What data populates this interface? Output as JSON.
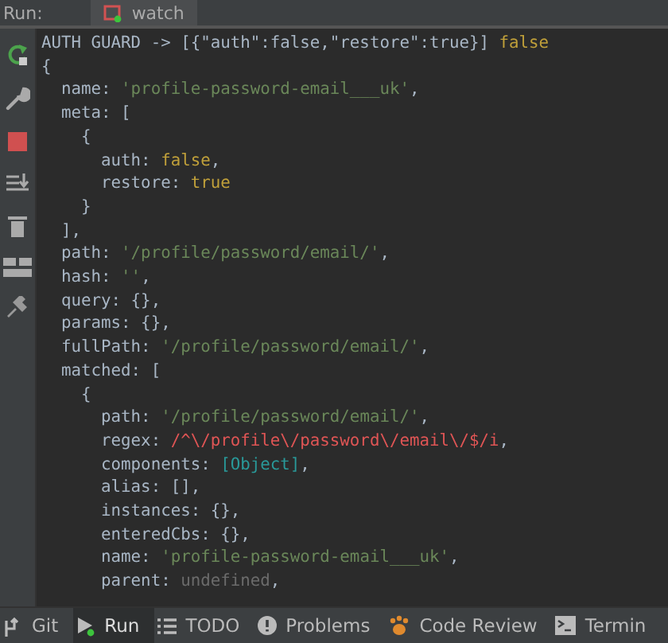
{
  "top_bar": {
    "label": "Run:",
    "tabs": [
      {
        "label": "watch",
        "selected": true
      }
    ]
  },
  "console_lines": [
    {
      "segments": [
        {
          "kind": "plain",
          "text": "AUTH GUARD -> [{\"auth\":false,\"restore\":true}] "
        },
        {
          "kind": "bool",
          "text": "false"
        }
      ]
    },
    {
      "segments": [
        {
          "kind": "plain",
          "text": "{"
        }
      ]
    },
    {
      "segments": [
        {
          "kind": "plain",
          "text": "  name: "
        },
        {
          "kind": "string",
          "text": "'profile-password-email___uk'"
        },
        {
          "kind": "plain",
          "text": ","
        }
      ]
    },
    {
      "segments": [
        {
          "kind": "plain",
          "text": "  meta: ["
        }
      ]
    },
    {
      "segments": [
        {
          "kind": "plain",
          "text": "    {"
        }
      ]
    },
    {
      "segments": [
        {
          "kind": "plain",
          "text": "      auth: "
        },
        {
          "kind": "bool",
          "text": "false"
        },
        {
          "kind": "plain",
          "text": ","
        }
      ]
    },
    {
      "segments": [
        {
          "kind": "plain",
          "text": "      restore: "
        },
        {
          "kind": "bool",
          "text": "true"
        }
      ]
    },
    {
      "segments": [
        {
          "kind": "plain",
          "text": "    }"
        }
      ]
    },
    {
      "segments": [
        {
          "kind": "plain",
          "text": "  ],"
        }
      ]
    },
    {
      "segments": [
        {
          "kind": "plain",
          "text": "  path: "
        },
        {
          "kind": "string",
          "text": "'/profile/password/email/'"
        },
        {
          "kind": "plain",
          "text": ","
        }
      ]
    },
    {
      "segments": [
        {
          "kind": "plain",
          "text": "  hash: "
        },
        {
          "kind": "string",
          "text": "''"
        },
        {
          "kind": "plain",
          "text": ","
        }
      ]
    },
    {
      "segments": [
        {
          "kind": "plain",
          "text": "  query: {},"
        }
      ]
    },
    {
      "segments": [
        {
          "kind": "plain",
          "text": "  params: {},"
        }
      ]
    },
    {
      "segments": [
        {
          "kind": "plain",
          "text": "  fullPath: "
        },
        {
          "kind": "string",
          "text": "'/profile/password/email/'"
        },
        {
          "kind": "plain",
          "text": ","
        }
      ]
    },
    {
      "segments": [
        {
          "kind": "plain",
          "text": "  matched: ["
        }
      ]
    },
    {
      "segments": [
        {
          "kind": "plain",
          "text": "    {"
        }
      ]
    },
    {
      "segments": [
        {
          "kind": "plain",
          "text": "      path: "
        },
        {
          "kind": "string",
          "text": "'/profile/password/email/'"
        },
        {
          "kind": "plain",
          "text": ","
        }
      ]
    },
    {
      "segments": [
        {
          "kind": "plain",
          "text": "      regex: "
        },
        {
          "kind": "regex",
          "text": "/^\\/profile\\/password\\/email\\/$/i"
        },
        {
          "kind": "plain",
          "text": ","
        }
      ]
    },
    {
      "segments": [
        {
          "kind": "plain",
          "text": "      components: "
        },
        {
          "kind": "object",
          "text": "[Object]"
        },
        {
          "kind": "plain",
          "text": ","
        }
      ]
    },
    {
      "segments": [
        {
          "kind": "plain",
          "text": "      alias: [],"
        }
      ]
    },
    {
      "segments": [
        {
          "kind": "plain",
          "text": "      instances: {},"
        }
      ]
    },
    {
      "segments": [
        {
          "kind": "plain",
          "text": "      enteredCbs: {},"
        }
      ]
    },
    {
      "segments": [
        {
          "kind": "plain",
          "text": "      name: "
        },
        {
          "kind": "string",
          "text": "'profile-password-email___uk'"
        },
        {
          "kind": "plain",
          "text": ","
        }
      ]
    },
    {
      "segments": [
        {
          "kind": "plain",
          "text": "      parent: "
        },
        {
          "kind": "undefined",
          "text": "undefined"
        },
        {
          "kind": "plain",
          "text": ","
        }
      ]
    }
  ],
  "tool_tabs": [
    {
      "kind": "git",
      "label": "Git",
      "selected": false
    },
    {
      "kind": "run",
      "label": "Run",
      "selected": true
    },
    {
      "kind": "todo",
      "label": "TODO",
      "selected": false
    },
    {
      "kind": "problems",
      "label": "Problems",
      "selected": false
    },
    {
      "kind": "review",
      "label": "Code Review",
      "selected": false
    },
    {
      "kind": "terminal",
      "label": "Termin",
      "selected": false
    }
  ]
}
